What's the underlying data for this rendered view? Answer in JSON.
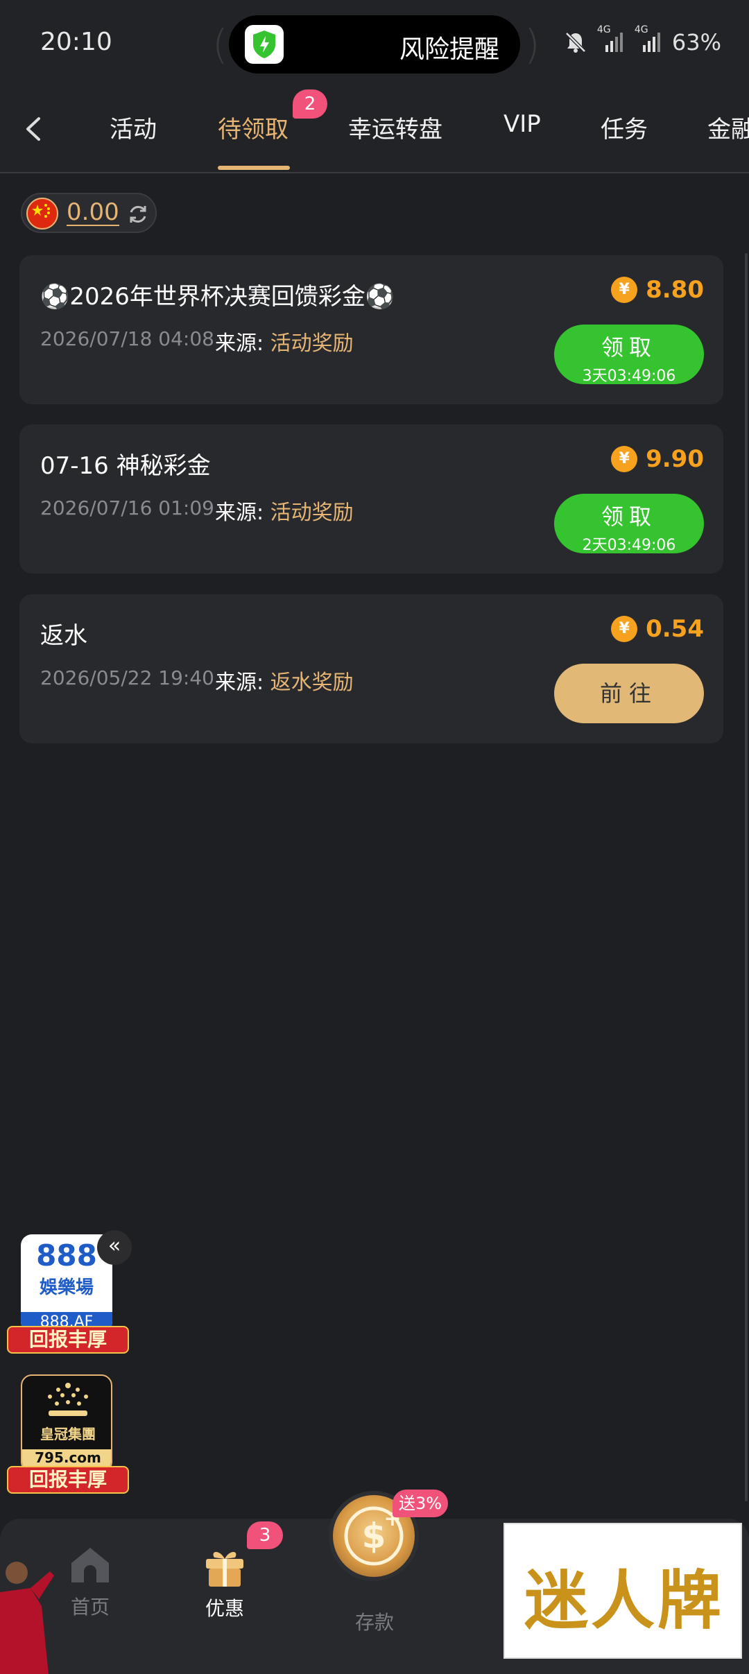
{
  "status_bar": {
    "time": "20:10",
    "island_text": "风险提醒",
    "net1": "4G",
    "net2": "4G",
    "battery": "63%"
  },
  "tabs": [
    {
      "label": "活动"
    },
    {
      "label": "待领取",
      "badge": "2",
      "active": true
    },
    {
      "label": "幸运转盘"
    },
    {
      "label": "VIP"
    },
    {
      "label": "任务"
    },
    {
      "label": "金融"
    }
  ],
  "balance": {
    "value": "0.00"
  },
  "source_prefix": "来源:",
  "rewards": [
    {
      "title": "⚽2026年世界杯决赛回馈彩金⚽",
      "date": "2026/07/18 04:08",
      "source": "活动奖励",
      "amount": "8.80",
      "button": "领取",
      "countdown": "3天03:49:06"
    },
    {
      "title": "07-16 神秘彩金",
      "date": "2026/07/16 01:09",
      "source": "活动奖励",
      "amount": "9.90",
      "button": "领取",
      "countdown": "2天03:49:06"
    },
    {
      "title": "返水",
      "date": "2026/05/22 19:40",
      "source": "返水奖励",
      "amount": "0.54",
      "button": "前往"
    }
  ],
  "coin_symbol": "¥",
  "float_ads": [
    {
      "top": "888",
      "middle": "娛樂場",
      "url": "888.AF",
      "ribbon": "回报丰厚"
    },
    {
      "name": "皇冠集團",
      "url": "795.com",
      "ribbon": "回报丰厚"
    }
  ],
  "bottom_nav": {
    "home": "首页",
    "promo": "优惠",
    "promo_badge": "3",
    "deposit": "存款",
    "deposit_badge": "送3%"
  },
  "brand_ad": "迷人牌",
  "colors": {
    "accent": "#e6b574",
    "claim_green": "#35c42f",
    "coin": "#f6a21f",
    "badge": "#f0527a"
  }
}
